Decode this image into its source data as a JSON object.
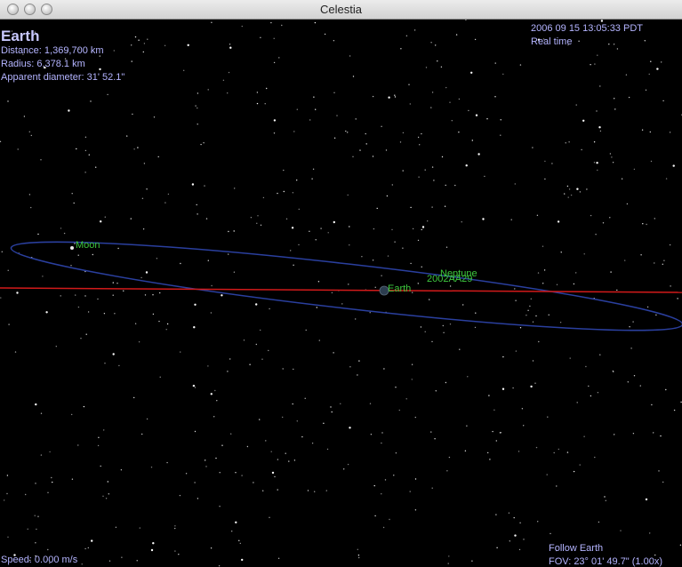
{
  "window": {
    "title": "Celestia"
  },
  "info": {
    "object_name": "Earth",
    "distance": "Distance: 1,369,700 km",
    "radius": "Radius: 6,378.1 km",
    "apparent_diameter": "Apparent diameter: 31' 52.1\""
  },
  "time": {
    "datetime": "2006 09 15 13:05:33 PDT",
    "mode": "Real time"
  },
  "status": {
    "speed": "Speed: 0.000 m/s",
    "follow": "Follow Earth",
    "fov": "FOV: 23° 01' 49.7\" (1.00x)"
  },
  "labels": {
    "moon": "Moon",
    "earth": "Earth",
    "neptune": "Neptune",
    "asteroid": "2002AA29"
  },
  "colors": {
    "hud_text": "#b4b4ff",
    "orbit_moon": "#2a3f9e",
    "orbit_earth": "#d21a1a",
    "label": "#3ec83e"
  }
}
